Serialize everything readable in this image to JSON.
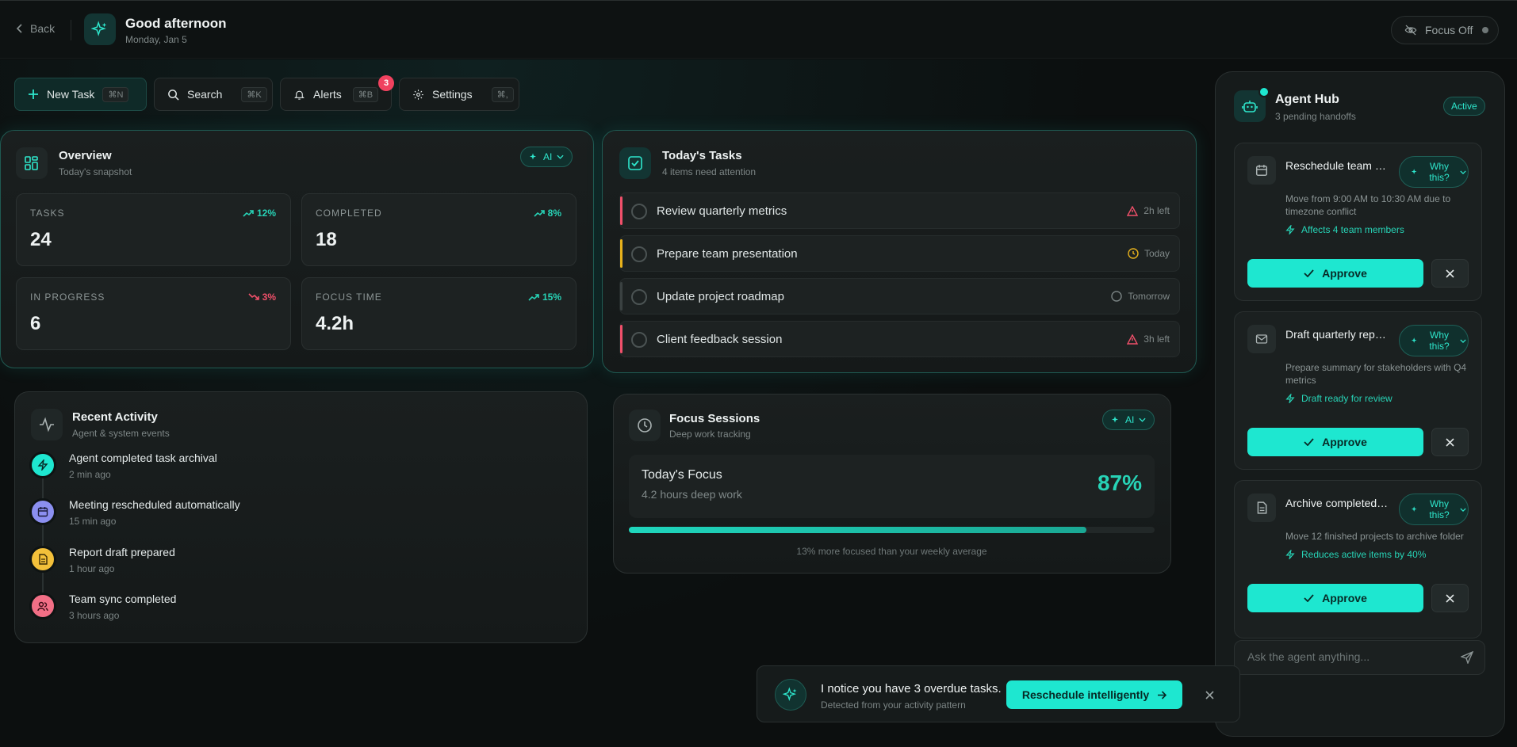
{
  "header": {
    "back_label": "Back",
    "greeting": "Good afternoon",
    "date": "Monday, Jan 5",
    "focus_label": "Focus Off"
  },
  "toolbar": {
    "new_task": {
      "label": "New Task",
      "shortcut": "⌘N"
    },
    "search": {
      "label": "Search",
      "shortcut": "⌘K"
    },
    "alerts": {
      "label": "Alerts",
      "shortcut": "⌘B",
      "badge": "3"
    },
    "settings": {
      "label": "Settings",
      "shortcut": "⌘,"
    }
  },
  "overview": {
    "title": "Overview",
    "subtitle": "Today's snapshot",
    "ai_label": "AI",
    "stats": [
      {
        "label": "TASKS",
        "value": "24",
        "change": "12%",
        "trend": "up"
      },
      {
        "label": "COMPLETED",
        "value": "18",
        "change": "8%",
        "trend": "up"
      },
      {
        "label": "IN PROGRESS",
        "value": "6",
        "change": "3%",
        "trend": "down"
      },
      {
        "label": "FOCUS TIME",
        "value": "4.2h",
        "change": "15%",
        "trend": "up"
      }
    ]
  },
  "tasks": {
    "title": "Today's Tasks",
    "subtitle": "4 items need attention",
    "items": [
      {
        "name": "Review quarterly metrics",
        "due": "2h left",
        "status_color": "#f0506a",
        "icon": "warning-icon"
      },
      {
        "name": "Prepare team presentation",
        "due": "Today",
        "status_color": "#e8b21c",
        "icon": "clock-icon"
      },
      {
        "name": "Update project roadmap",
        "due": "Tomorrow",
        "status_color": "#3a4141",
        "icon": "circle-icon"
      },
      {
        "name": "Client feedback session",
        "due": "3h left",
        "status_color": "#f0506a",
        "icon": "warning-icon"
      }
    ]
  },
  "activity": {
    "title": "Recent Activity",
    "subtitle": "Agent & system events",
    "items": [
      {
        "text": "Agent completed task archival",
        "time": "2 min ago",
        "color": "#1ee7d0",
        "icon": "bolt-icon"
      },
      {
        "text": "Meeting rescheduled automatically",
        "time": "15 min ago",
        "color": "#8b8ff0",
        "icon": "calendar-icon"
      },
      {
        "text": "Report draft prepared",
        "time": "1 hour ago",
        "color": "#f3c03a",
        "icon": "document-icon"
      },
      {
        "text": "Team sync completed",
        "time": "3 hours ago",
        "color": "#f26f86",
        "icon": "users-icon"
      }
    ]
  },
  "focus": {
    "title": "Focus Sessions",
    "subtitle": "Deep work tracking",
    "ai_label": "AI",
    "today_label": "Today's Focus",
    "today_detail": "4.2 hours deep work",
    "percent_label": "87%",
    "percent_value": 0.87,
    "note": "13% more focused than your weekly average"
  },
  "agent_hub": {
    "title": "Agent Hub",
    "subtitle": "3 pending handoffs",
    "status": "Active",
    "why_label": "Why this?",
    "approve_label": "Approve",
    "handoffs": [
      {
        "title": "Reschedule team …",
        "desc": "Move from 9:00 AM to 10:30 AM due to timezone conflict",
        "tag": "Affects 4 team members",
        "icon": "calendar-icon"
      },
      {
        "title": "Draft quarterly rep…",
        "desc": "Prepare summary for stakeholders with Q4 metrics",
        "tag": "Draft ready for review",
        "icon": "mail-icon"
      },
      {
        "title": "Archive completed …",
        "desc": "Move 12 finished projects to archive folder",
        "tag": "Reduces active items by 40%",
        "icon": "document-icon"
      }
    ],
    "ask_placeholder": "Ask the agent anything..."
  },
  "toast": {
    "title": "I notice you have 3 overdue tasks.",
    "subtitle": "Detected from your activity pattern",
    "action_label": "Reschedule intelligently"
  },
  "colors": {
    "accent": "#1ee7d0",
    "danger": "#f0506a",
    "warning": "#e8b21c"
  }
}
